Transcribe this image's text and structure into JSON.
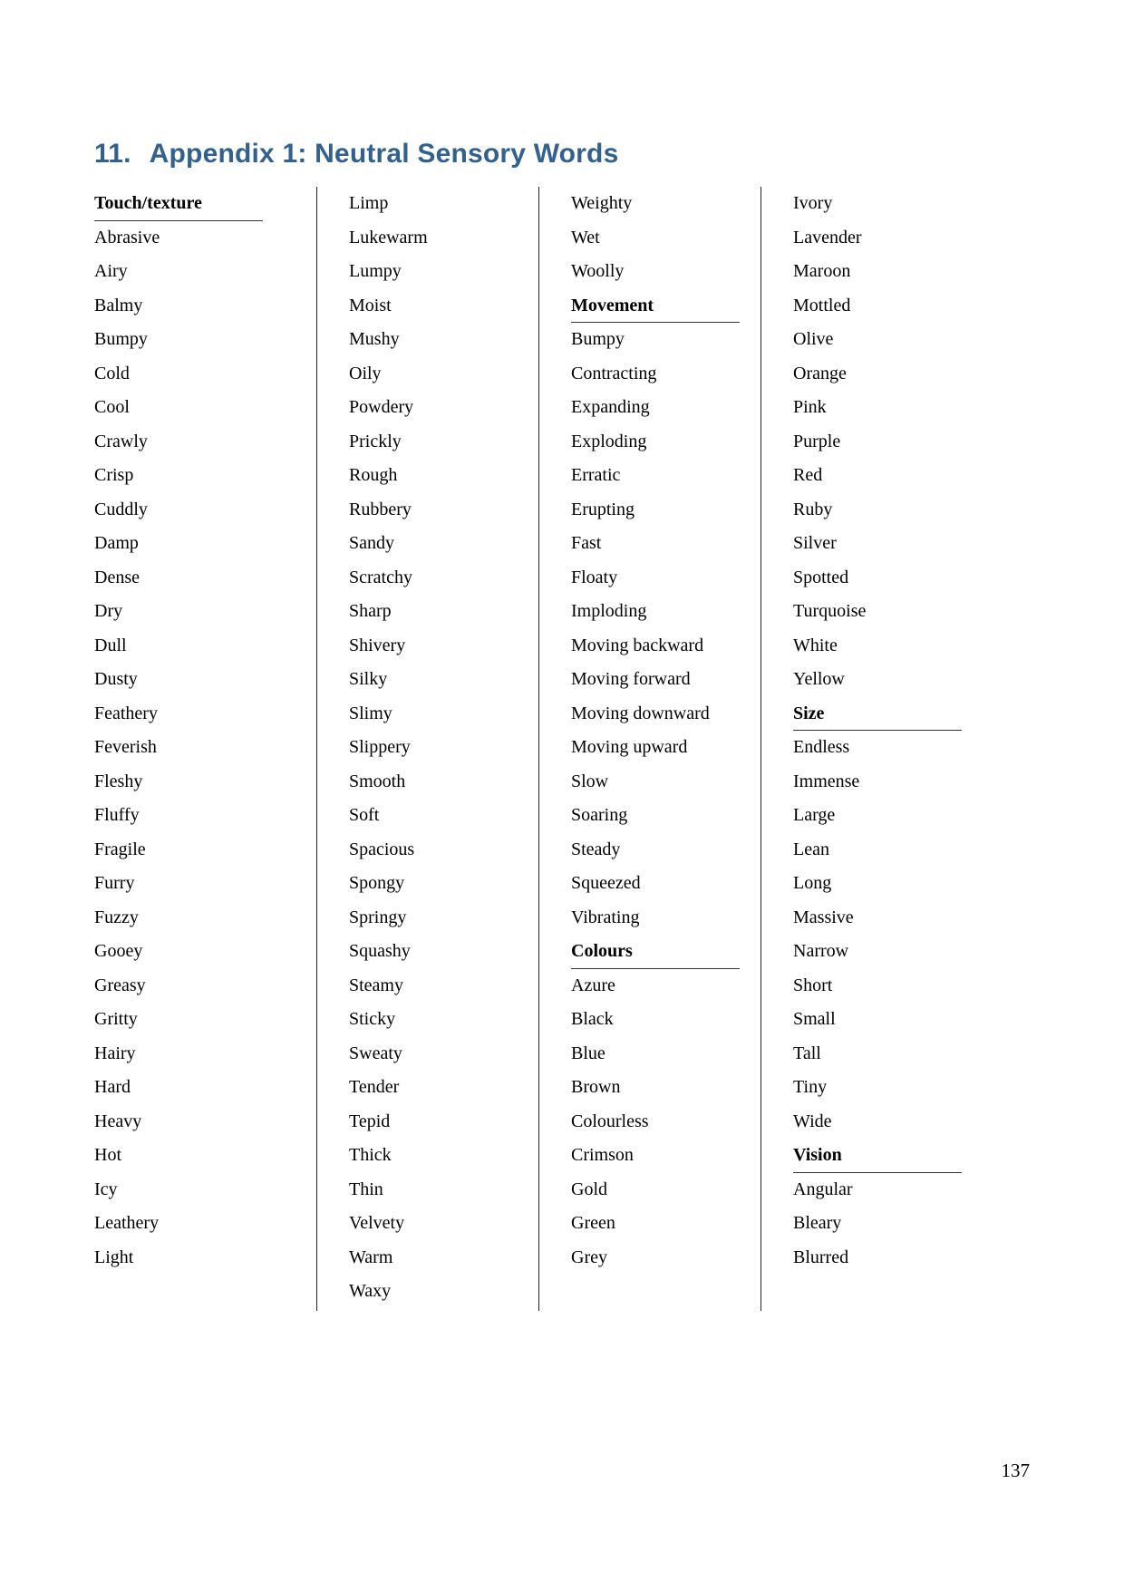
{
  "document": {
    "title_number": "11.",
    "title_text": "Appendix 1: Neutral Sensory Words",
    "title_color": "#33618f",
    "page_number": "137"
  },
  "columns": [
    {
      "id": "column-1",
      "has_divider": false,
      "blocks": [
        {
          "type": "heading",
          "label": "Touch/texture"
        },
        {
          "type": "words",
          "items": [
            "Abrasive",
            "Airy",
            "Balmy",
            "Bumpy",
            "Cold",
            "Cool",
            "Crawly",
            "Crisp",
            "Cuddly",
            "Damp",
            "Dense",
            "Dry",
            "Dull",
            "Dusty",
            "Feathery",
            "Feverish",
            "Fleshy",
            "Fluffy",
            "Fragile",
            "Furry",
            "Fuzzy",
            "Gooey",
            "Greasy",
            "Gritty",
            "Hairy",
            "Hard",
            "Heavy",
            "Hot",
            "Icy",
            "Leathery",
            "Light"
          ]
        }
      ]
    },
    {
      "id": "column-2",
      "has_divider": true,
      "blocks": [
        {
          "type": "words",
          "items": [
            "Limp",
            "Lukewarm",
            "Lumpy",
            "Moist",
            "Mushy",
            "Oily",
            "Powdery",
            "Prickly",
            "Rough",
            "Rubbery",
            "Sandy",
            "Scratchy",
            "Sharp",
            "Shivery",
            "Silky",
            "Slimy",
            "Slippery",
            "Smooth",
            "Soft",
            "Spacious",
            "Spongy",
            "Springy",
            "Squashy",
            "Steamy",
            "Sticky",
            "Sweaty",
            "Tender",
            "Tepid",
            "Thick",
            "Thin",
            "Velvety",
            "Warm",
            "Waxy"
          ]
        }
      ]
    },
    {
      "id": "column-3",
      "has_divider": true,
      "blocks": [
        {
          "type": "words",
          "items": [
            "Weighty",
            "Wet",
            "Woolly"
          ]
        },
        {
          "type": "heading",
          "label": "Movement"
        },
        {
          "type": "words",
          "items": [
            "Bumpy",
            "Contracting",
            "Expanding",
            "Exploding",
            "Erratic",
            "Erupting",
            "Fast",
            "Floaty",
            "Imploding",
            "Moving backward",
            "Moving forward",
            "Moving downward",
            "Moving upward",
            "Slow",
            "Soaring",
            "Steady",
            "Squeezed",
            "Vibrating"
          ]
        },
        {
          "type": "heading",
          "label": "Colours"
        },
        {
          "type": "words",
          "items": [
            "Azure",
            "Black",
            "Blue",
            "Brown",
            "Colourless",
            "Crimson",
            "Gold",
            "Green",
            "Grey"
          ]
        }
      ]
    },
    {
      "id": "column-4",
      "has_divider": true,
      "blocks": [
        {
          "type": "words",
          "items": [
            "Ivory",
            "Lavender",
            "Maroon",
            "Mottled",
            "Olive",
            "Orange",
            "Pink",
            "Purple",
            "Red",
            "Ruby",
            "Silver",
            "Spotted",
            "Turquoise",
            "White",
            "Yellow"
          ]
        },
        {
          "type": "heading",
          "label": "Size"
        },
        {
          "type": "words",
          "items": [
            "Endless",
            "Immense",
            "Large",
            "Lean",
            "Long",
            "Massive",
            "Narrow",
            "Short",
            "Small",
            "Tall",
            "Tiny",
            "Wide"
          ]
        },
        {
          "type": "heading",
          "label": "Vision"
        },
        {
          "type": "words",
          "items": [
            "Angular",
            "Bleary",
            "Blurred"
          ]
        }
      ]
    }
  ]
}
